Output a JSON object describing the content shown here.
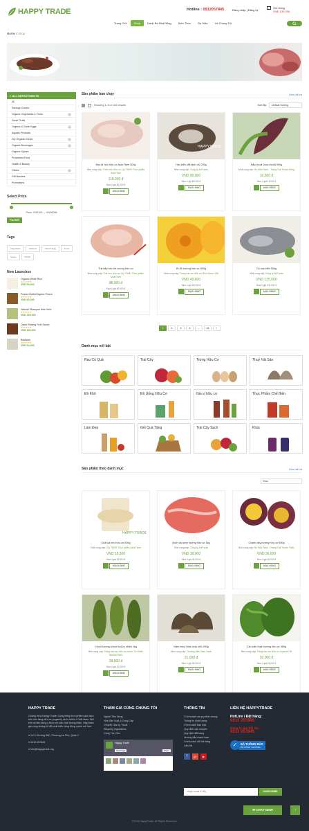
{
  "header": {
    "brand": "HAPPY TRADE",
    "hotline_label": "Hotline :",
    "hotline_number": "0912057845",
    "login": "Đăng nhập | Đăng ký",
    "cart_label": "Giỏ Hàng",
    "cart_total": "VND 130.000"
  },
  "nav": [
    "Trang Chủ",
    "Shop",
    "Danh Bạ Nhà Nông",
    "Kiến Thức",
    "Sự Kiện",
    "Về Chúng Tôi"
  ],
  "breadcrumb": {
    "home": "Home",
    "sep": "/",
    "current": "Shop"
  },
  "sidebar": {
    "departments_title": "ALL DEPARTMENTS",
    "items": [
      "All",
      "Savings Combo",
      "Organic Vegetables & Fruits",
      "Fresh Fruits",
      "Organic & Clean Eggs",
      "Aquatic Products",
      "Dry Organic Snops",
      "Organic Beverages",
      "Organic Spices",
      "Processed Food",
      "Health & Beauty",
      "Others",
      "Gift Baskets",
      "Promotions"
    ],
    "price_title": "Select Price",
    "price_range": "Price: VND100 — VND5008",
    "filter_button": "FILTER",
    "tags_title": "Tags",
    "tags": [
      "Vegetables",
      "Seafood",
      "Meat & Egg",
      "Fruits",
      "Soups",
      "Drinks"
    ],
    "new_title": "New Launches",
    "new_items": [
      {
        "name": "Organic White Rice",
        "price": "VND 90,000"
      },
      {
        "name": "Peanut ButterOrganic Peach",
        "price": "VND 60,000"
      },
      {
        "name": "Natural Shampoo Aloe Vera",
        "price": "VND 165,000"
      },
      {
        "name": "Oasis Raising Fruit Sauce",
        "price": "VND 102,000"
      },
      {
        "name": "Basilarm",
        "price": "VND 60,000"
      }
    ]
  },
  "bestseller": {
    "title": "Sản phẩm bán chạy",
    "more": "Xem tất cả",
    "showing": "Showing 1- 6 of 163 results",
    "sort_label": "Sort By:",
    "sort_value": "Default Sorting",
    "products": [
      {
        "name": "Bao tử heo hữu cơ Asia Farm 500g",
        "sup_label": "Nhà cung cấp:",
        "supplier": "Thiết heo hữu cơ Cty TNHH Thực phẩm Asia Farm",
        "price": "118,000 đ",
        "min": "Mua 4 giá 85,000 đ",
        "buy": "MUA HÀNG"
      },
      {
        "name": "Hàu biển (đã tách vỏ) 200g",
        "sup_label": "Nhà cung cấp:",
        "supplier": "Công ty AnFoods",
        "price": "VND 80,000",
        "min": "Mua 4 giá 65,000 đ",
        "buy": "MUA HÀNG"
      },
      {
        "name": "Bắp chuối (hoa chuối) 500g",
        "sup_label": "Nhà cung cấp:",
        "supplier": "Ân Mộc Farm - Trang Trại Thuận Nông",
        "price": "16,500 đ",
        "min": "Mua 4 giá 13,000 đ",
        "buy": "MUA HÀNG"
      },
      {
        "name": "Thịt bắp heo rút xương hữu cơ",
        "sup_label": "Nhà cung cấp:",
        "supplier": "Thịt heo hữu cơ Cty TNHH Thực phẩm Asia Farm",
        "price": "88,000 đ",
        "min": "Mua 4 giá 60,000 đ",
        "buy": "MUA HÀNG"
      },
      {
        "name": "Bí đỏ hướng hữu cơ 800g",
        "sup_label": "Nhà cung cấp:",
        "supplier": "Trang trại rau hữu cơ Rico Nicco Việt",
        "price": "VND 49,600",
        "min": "Mua 4 giá 45,000 đ",
        "buy": "MUA HÀNG"
      },
      {
        "name": "Cá nâu biển 500g",
        "sup_label": "Nhà cung cấp:",
        "supplier": "Công ty AnFoods",
        "price": "VND 125,000",
        "min": "Mua 3 giá 100,000 đ",
        "buy": "MUA HÀNG"
      }
    ]
  },
  "pager": [
    "1",
    "2",
    "3",
    "4",
    "...",
    "44",
    "›"
  ],
  "categories": {
    "title": "Danh mục nổi bật",
    "items": [
      "Rau Củ Quả",
      "Trái Cây",
      "Trứng Hữu Cơ",
      "Thuỷ Hải Sản",
      "Đồ Khô",
      "Đồ Uống Hữu Cơ",
      "Gia vị hữu cơ",
      "Thực Phẩm Chế Biến",
      "Làm Đẹp",
      "Giỏ Quà Tặng",
      "Trái Cây Sạch",
      "Khác"
    ]
  },
  "bycat": {
    "title": "Sản phẩm theo danh mục",
    "more": "Xem tất cả",
    "filter": "Rau",
    "products": [
      {
        "name": "Chả lụa heo hữu cơ 500g",
        "sup_label": "Nhà cung cấp:",
        "supplier": "Cty TNHH Thực phẩm Asia Farm",
        "price": "VND 18,500",
        "min": "Mua 4 giá 15,500 đ",
        "buy": "MUA HÀNG"
      },
      {
        "name": "Bưởi da xanh hướng hữu cơ 1kg",
        "sup_label": "Nhà cung cấp:",
        "supplier": "Công ty AnFoods",
        "price": "VND 38,000",
        "min": "Mua 3 giá 30,000 đ",
        "buy": "MUA HÀNG"
      },
      {
        "name": "Chanh dây hướng hữu cơ 500g",
        "sup_label": "Nhà cung cấp:",
        "supplier": "Ân Mộc Farm - Trang Trại Thuận Thiên",
        "price": "VND 36,000",
        "min": "Mua 4 giá 30,000 đ",
        "buy": "MUA HÀNG"
      },
      {
        "name": "Chuối hương (chuối sứ) tự nhiên 1kg",
        "sup_label": "Nhà cung cấp:",
        "supplier": "Trang trại rau hữu cơ Nước Tự Nhiên Natural Farm",
        "price": "28,000 đ",
        "min": "Mua 4 giá 25,000 đ",
        "buy": "MUA HÀNG"
      },
      {
        "name": "Nấm mộc( Nấm mộc nhĩ) 200g",
        "sup_label": "Nhà cung cấp:",
        "supplier": "Thương hiệu Sâm Xanh",
        "price": "31,000 đ",
        "min": "Mua 3 giá 28,000 đ",
        "buy": "MUA HÀNG"
      },
      {
        "name": "Cải xoăn Kale hướng hữu cơ 300g",
        "sup_label": "Nhà cung cấp:",
        "supplier": "Trang trại rau hữu cơ Organik VN",
        "price": "30,000 đ",
        "min": "Mua 4 giá 25,000 đ",
        "buy": "MUA HÀNG"
      }
    ]
  },
  "footer": {
    "col1_title": "HAPPY TRADE",
    "col1_text": "Chúng tôi là Happy Trade! Cộng đồng thực phẩm sạch dựa trên nền tảng hữu cơ (organic) và tự nhiên ở Việt Nam. Nơi kết nối tiêu dùng ý thức với sản xuất lương thiện. Hãy tham gia cùng chúng tôi để phát triển cộng đồng mạnh mẽ hơn.",
    "address": "Số 3, Đường 36C, Phường An Phú, Quận 2",
    "phone": "0912.057845",
    "email": "info@happytrade.org",
    "col2_title": "THAM GIA CÙNG CHÚNG TÔI",
    "col2_links": [
      "Người Tiêu Dùng",
      "Nhà Sản Xuất & Cung Cấp",
      "Chuyên Gia Kỹ Thuật",
      "Shipping regulations",
      "Cộng Tác Viên"
    ],
    "fb_name": "Happy Trade",
    "fb_like": "Like Page",
    "fb_share": "Share",
    "col3_title": "THÔNG TIN",
    "col3_links": [
      "Chính sách và quy định chung",
      "Thông tin chất lượng",
      "Chính sách bảo mật",
      "Quy định vận chuyển",
      "Quy định đổi hàng",
      "Hướng dẫn thanh toán",
      "Chính sách đổi trả hàng",
      "Liên Hệ"
    ],
    "col4_title": "LIÊN HỆ HAPPYTRADE",
    "hotline_label": "HotLine / Đặt hàng:",
    "hotline": "0912 057845",
    "partner_label": "Đăng kí làm đối tác:",
    "partner": "0912 057845",
    "badge_line1": "ĐÃ THÔNG BÁO",
    "badge_line2": "BỘ CÔNG THƯƠNG",
    "email_placeholder": "Nhập email ở đây",
    "subscribe": "SUBSCRIBE",
    "copyright": "©2016 HappyTrade. All Rights Reserved."
  },
  "chat": "CHAT NOW",
  "colors": {
    "green": "#6aa33d",
    "red": "#d9261c",
    "footer": "#242a33"
  }
}
